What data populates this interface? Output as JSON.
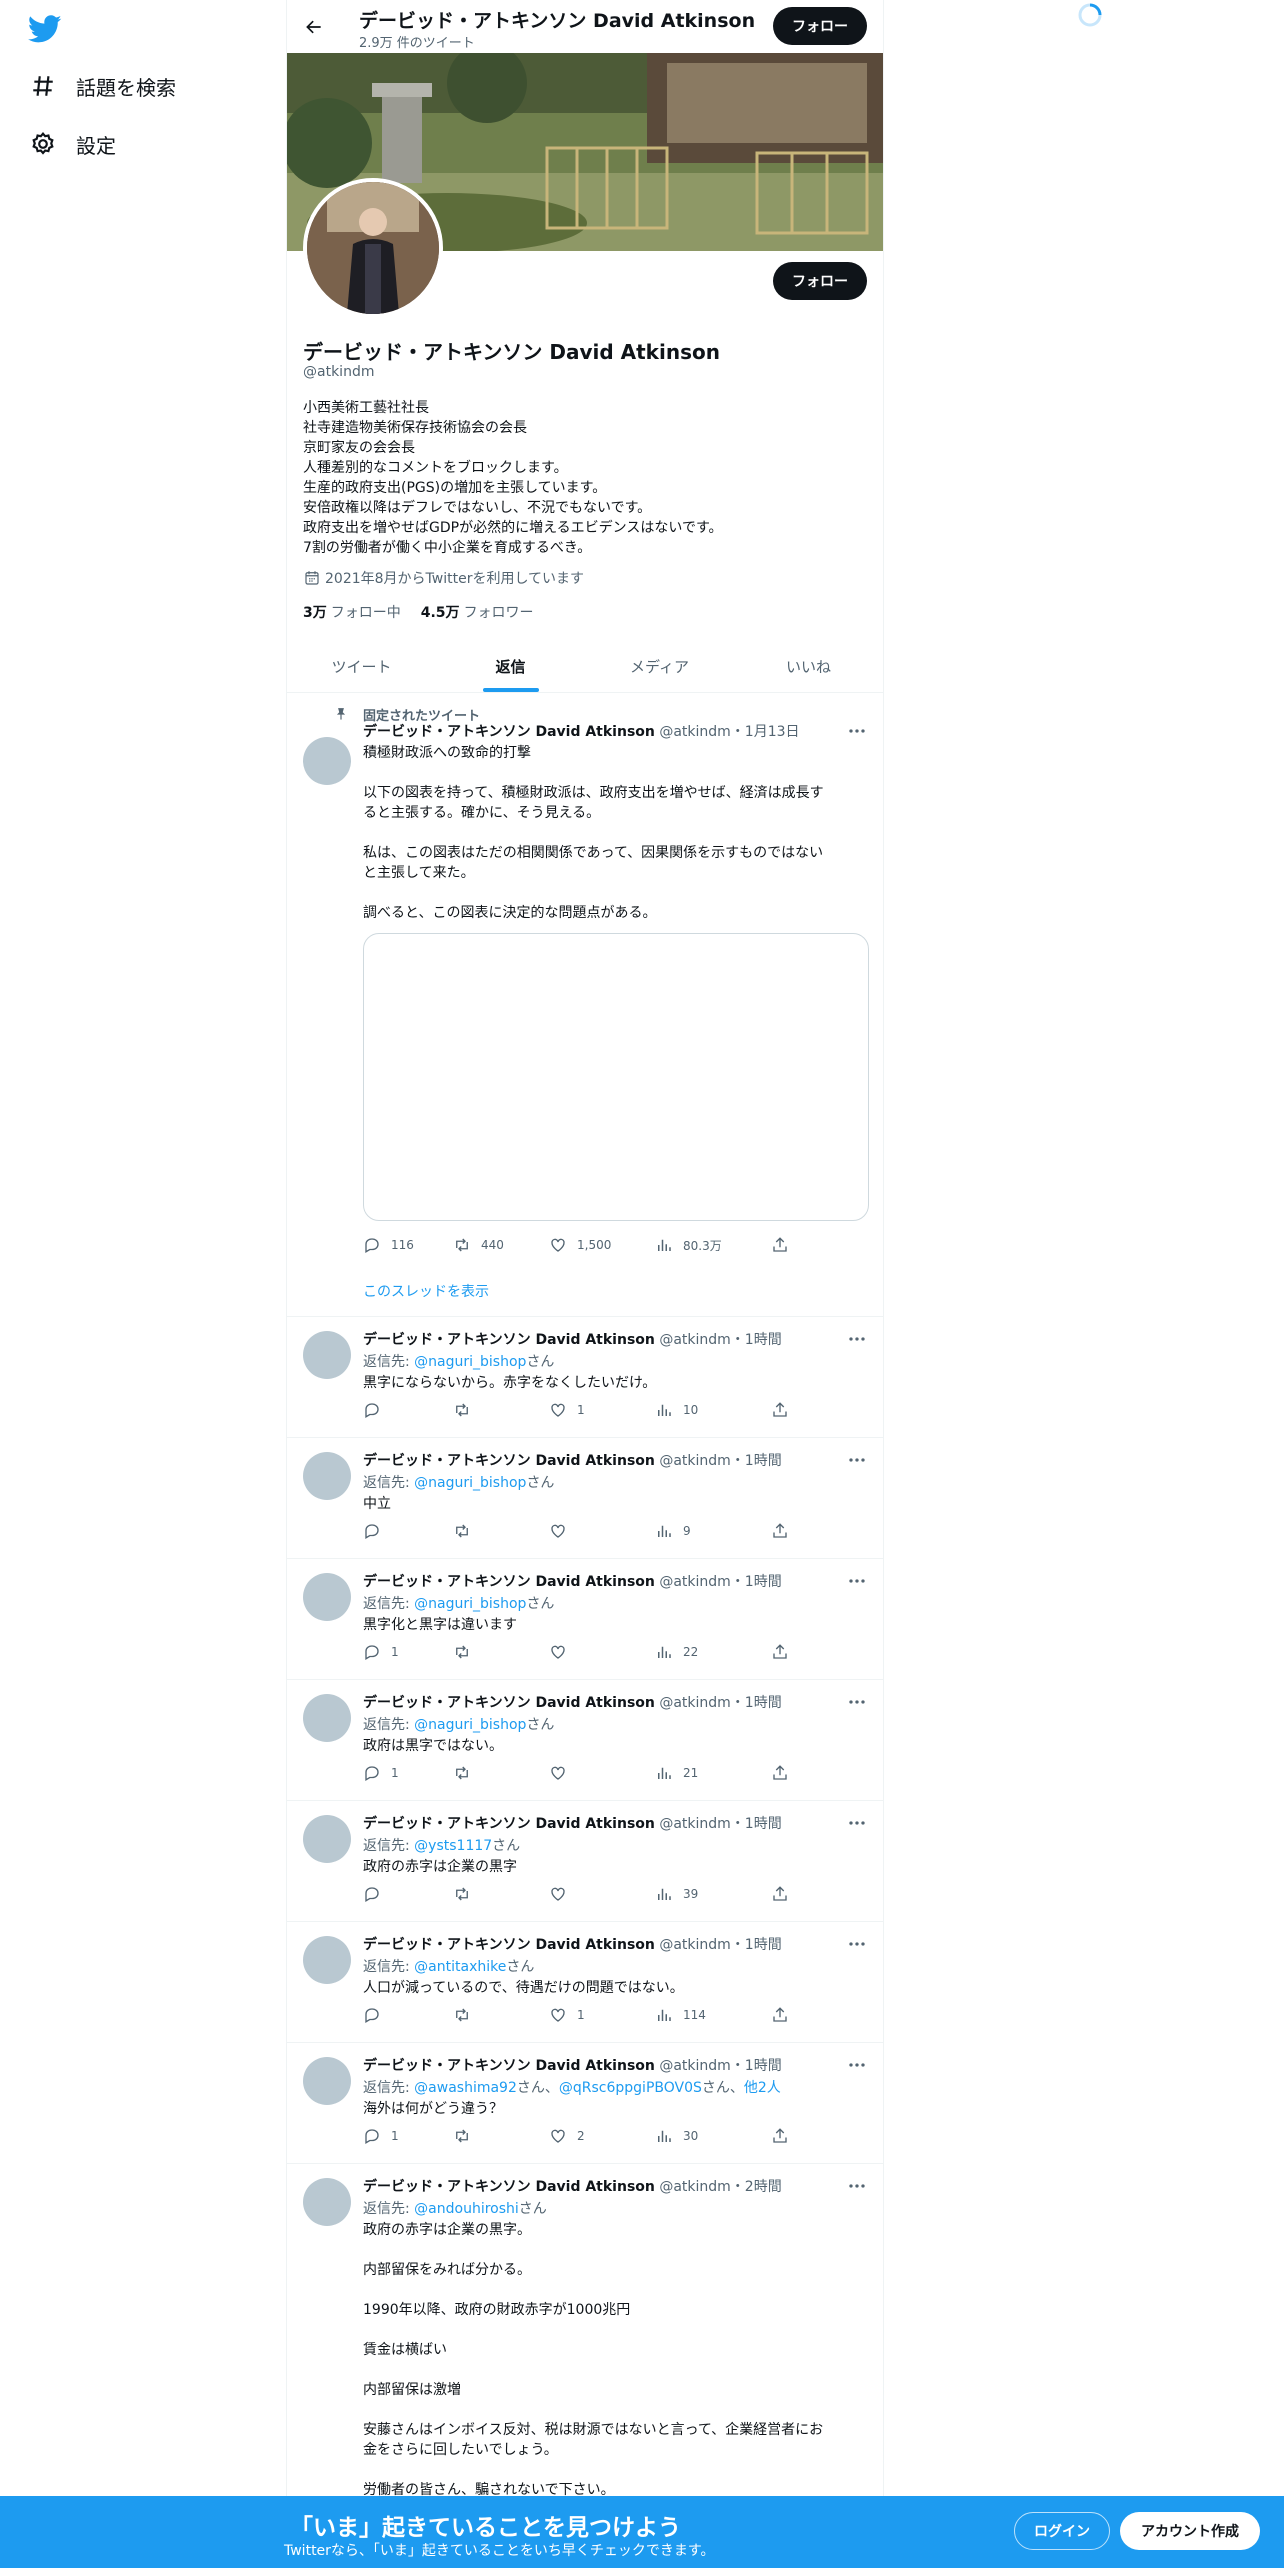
{
  "nav": {
    "explore_label": "話題を検索",
    "settings_label": "設定"
  },
  "topbar": {
    "name": "デービッド・アトキンソン David Atkinson",
    "tweet_count": "2.9万 件のツイート",
    "follow_label": "フォロー"
  },
  "profile": {
    "follow_label": "フォロー",
    "name": "デービッド・アトキンソン David Atkinson",
    "handle": "@atkindm",
    "bio": [
      "小西美術工藝社社長",
      "社寺建造物美術保存技術協会の会長",
      "京町家友の会会長",
      "人種差別的なコメントをブロックします。",
      "生産的政府支出(PGS)の増加を主張しています。",
      "安倍政権以降はデフレではないし、不況でもないです。",
      "政府支出を増やせばGDPが必然的に増えるエビデンスはないです。",
      "7割の労働者が働く中小企業を育成するべき。"
    ],
    "joined": "2021年8月からTwitterを利用しています",
    "following_count": "3万",
    "following_label": "フォロー中",
    "followers_count": "4.5万",
    "followers_label": "フォロワー"
  },
  "tabs": [
    {
      "label": "ツイート",
      "active": false
    },
    {
      "label": "返信",
      "active": true
    },
    {
      "label": "メディア",
      "active": false
    },
    {
      "label": "いいね",
      "active": false
    }
  ],
  "pinned": {
    "pinned_label": "固定されたツイート",
    "name": "デービッド・アトキンソン David Atkinson",
    "meta": "@atkindm・1月13日",
    "text": [
      "積極財政派への致命的打撃",
      "",
      "以下の図表を持って、積極財政派は、政府支出を増やせば、経済は成長す",
      "ると主張する。確かに、そう見える。",
      "",
      "私は、この図表はただの相関関係であって、因果関係を示すものではない",
      "と主張して来た。",
      "",
      "調べると、この図表に決定的な問題点がある。"
    ],
    "replies": "116",
    "retweets": "440",
    "likes": "1,500",
    "views": "80.3万",
    "show_thread": "このスレッドを表示"
  },
  "replies": [
    {
      "name": "デービッド・アトキンソン David Atkinson",
      "meta": "@atkindm・1時間",
      "reply_prefix": "返信先: ",
      "reply_to": "@naguri_bishop",
      "reply_suffix": "さん",
      "text": [
        "黒字にならないから。赤字をなくしたいだけ。"
      ],
      "replies": "",
      "retweets": "",
      "likes": "1",
      "views": "10"
    },
    {
      "name": "デービッド・アトキンソン David Atkinson",
      "meta": "@atkindm・1時間",
      "reply_prefix": "返信先: ",
      "reply_to": "@naguri_bishop",
      "reply_suffix": "さん",
      "text": [
        "中立"
      ],
      "replies": "",
      "retweets": "",
      "likes": "",
      "views": "9"
    },
    {
      "name": "デービッド・アトキンソン David Atkinson",
      "meta": "@atkindm・1時間",
      "reply_prefix": "返信先: ",
      "reply_to": "@naguri_bishop",
      "reply_suffix": "さん",
      "text": [
        "黒字化と黒字は違います"
      ],
      "replies": "1",
      "retweets": "",
      "likes": "",
      "views": "22"
    },
    {
      "name": "デービッド・アトキンソン David Atkinson",
      "meta": "@atkindm・1時間",
      "reply_prefix": "返信先: ",
      "reply_to": "@naguri_bishop",
      "reply_suffix": "さん",
      "text": [
        "政府は黒字ではない。"
      ],
      "replies": "1",
      "retweets": "",
      "likes": "",
      "views": "21"
    },
    {
      "name": "デービッド・アトキンソン David Atkinson",
      "meta": "@atkindm・1時間",
      "reply_prefix": "返信先: ",
      "reply_to": "@ysts1117",
      "reply_suffix": "さん",
      "text": [
        "政府の赤字は企業の黒字"
      ],
      "replies": "",
      "retweets": "",
      "likes": "",
      "views": "39"
    },
    {
      "name": "デービッド・アトキンソン David Atkinson",
      "meta": "@atkindm・1時間",
      "reply_prefix": "返信先: ",
      "reply_to": "@antitaxhike",
      "reply_suffix": "さん",
      "text": [
        "人口が減っているので、待遇だけの問題ではない。"
      ],
      "replies": "",
      "retweets": "",
      "likes": "1",
      "views": "114"
    },
    {
      "name": "デービッド・アトキンソン David Atkinson",
      "meta": "@atkindm・1時間",
      "reply_prefix": "返信先: ",
      "reply_to": "@awashima92",
      "reply_suffix": "さん、",
      "reply_to2": "@qRsc6ppgiPBOV0S",
      "reply_suffix2": "さん、",
      "reply_others": "他2人",
      "text": [
        "海外は何がどう違う？"
      ],
      "replies": "1",
      "retweets": "",
      "likes": "2",
      "views": "30"
    },
    {
      "name": "デービッド・アトキンソン David Atkinson",
      "meta": "@atkindm・2時間",
      "reply_prefix": "返信先: ",
      "reply_to": "@andouhiroshi",
      "reply_suffix": "さん",
      "text": [
        "政府の赤字は企業の黒字。",
        "",
        "内部留保をみれば分かる。",
        "",
        "1990年以降、政府の財政赤字が1000兆円",
        "",
        "賃金は横ばい",
        "",
        "内部留保は激増",
        "",
        "安藤さんはインボイス反対、税は財源ではないと言って、企業経営者にお",
        "金をさらに回したいでしょう。",
        "",
        "労働者の皆さん、騙されないで下さい。"
      ]
    }
  ],
  "bottombar": {
    "title": "「いま」起きていることを見つけよう",
    "subtitle": "Twitterなら、「いま」起きていることをいち早くチェックできます。",
    "login_label": "ログイン",
    "signup_label": "アカウント作成"
  },
  "colors": {
    "accent": "#1d9bf0",
    "text": "#0f1419",
    "muted": "#536471",
    "border": "#eff3f4"
  }
}
